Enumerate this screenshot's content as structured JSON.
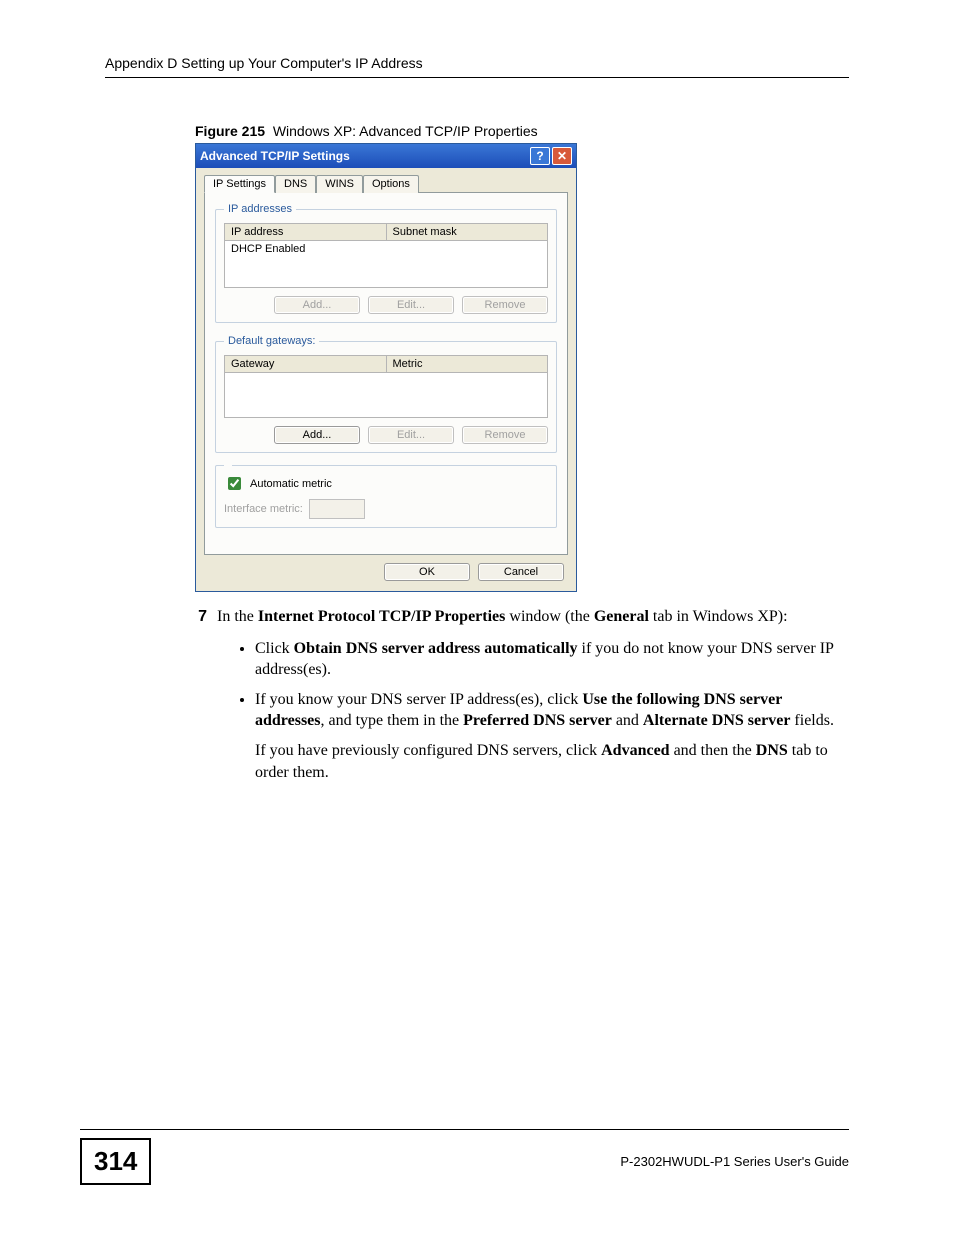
{
  "header": "Appendix D Setting up Your Computer's IP Address",
  "figure": {
    "label": "Figure 215",
    "caption": "Windows XP: Advanced TCP/IP Properties"
  },
  "dialog": {
    "title": "Advanced TCP/IP Settings",
    "tabs": {
      "ip": "IP Settings",
      "dns": "DNS",
      "wins": "WINS",
      "options": "Options"
    },
    "ip_group": {
      "legend": "IP addresses",
      "col_ip": "IP address",
      "col_mask": "Subnet mask",
      "row1": "DHCP Enabled",
      "add": "Add...",
      "edit": "Edit...",
      "remove": "Remove"
    },
    "gw_group": {
      "legend": "Default gateways:",
      "col_gw": "Gateway",
      "col_metric": "Metric",
      "add": "Add...",
      "edit": "Edit...",
      "remove": "Remove"
    },
    "metric_group": {
      "auto": "Automatic metric",
      "iface": "Interface metric:"
    },
    "footer": {
      "ok": "OK",
      "cancel": "Cancel"
    }
  },
  "step": {
    "num": "7",
    "text_a": "In the ",
    "bold1": "Internet Protocol TCP/IP Properties",
    "text_b": " window (the ",
    "bold2": "General",
    "text_c": " tab in Windows XP):"
  },
  "bullets": {
    "b1a": "Click ",
    "b1b": "Obtain DNS server address automatically",
    "b1c": " if you do not know your DNS server IP address(es).",
    "b2a": "If you know your DNS server IP address(es), click ",
    "b2b": "Use the following DNS server addresses",
    "b2c": ", and type them in the ",
    "b2d": "Preferred DNS server",
    "b2e": " and ",
    "b2f": "Alternate DNS server",
    "b2g": " fields."
  },
  "after": {
    "a": "If you have previously configured DNS servers, click ",
    "b": "Advanced",
    "c": " and then the ",
    "d": "DNS",
    "e": " tab to order them."
  },
  "footer": {
    "page": "314",
    "guide": "P-2302HWUDL-P1 Series User's Guide"
  }
}
